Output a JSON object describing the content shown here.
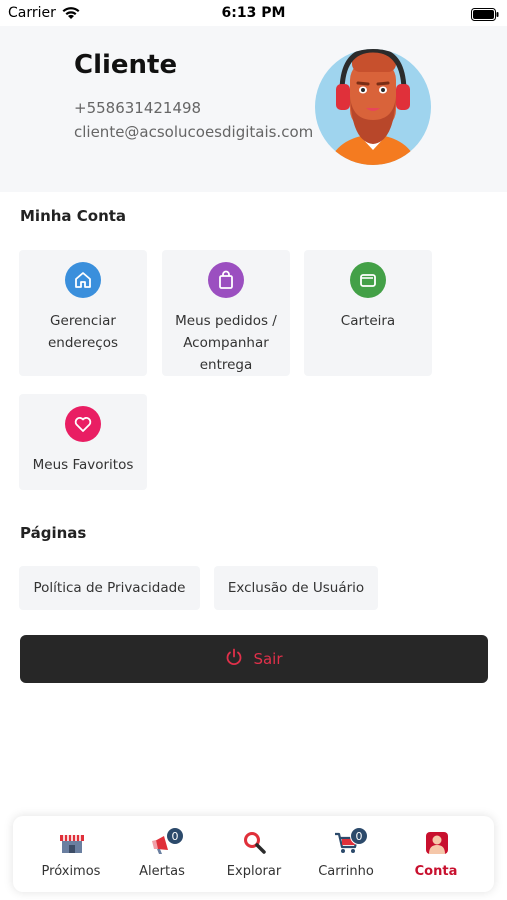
{
  "status_bar": {
    "carrier": "Carrier",
    "time": "6:13 PM"
  },
  "profile": {
    "name": "Cliente",
    "phone": "+558631421498",
    "email": "cliente@acsolucoesdigitais.com"
  },
  "my_account": {
    "title": "Minha Conta",
    "cards": [
      {
        "label": "Gerenciar endereços",
        "icon": "home-icon",
        "color": "#3a8fdc"
      },
      {
        "label": "Meus pedidos / Acompanhar entrega",
        "icon": "shopping-bag-icon",
        "color": "#9b4fc0"
      },
      {
        "label": "Carteira",
        "icon": "wallet-icon",
        "color": "#43a047"
      },
      {
        "label": "Meus Favoritos",
        "icon": "heart-icon",
        "color": "#e91e63"
      }
    ]
  },
  "pages": {
    "title": "Páginas",
    "links": [
      {
        "label": "Política de Privacidade"
      },
      {
        "label": "Exclusão de Usuário"
      }
    ]
  },
  "logout": {
    "label": "Sair",
    "icon": "power-icon",
    "color": "#e0304a"
  },
  "tab_bar": {
    "tabs": [
      {
        "label": "Próximos",
        "icon": "store-icon",
        "badge": null,
        "active": false
      },
      {
        "label": "Alertas",
        "icon": "megaphone-icon",
        "badge": "0",
        "active": false
      },
      {
        "label": "Explorar",
        "icon": "search-icon",
        "badge": null,
        "active": false
      },
      {
        "label": "Carrinho",
        "icon": "cart-icon",
        "badge": "0",
        "active": false
      },
      {
        "label": "Conta",
        "icon": "user-icon",
        "badge": null,
        "active": true
      }
    ],
    "active_color": "#c8102e"
  }
}
